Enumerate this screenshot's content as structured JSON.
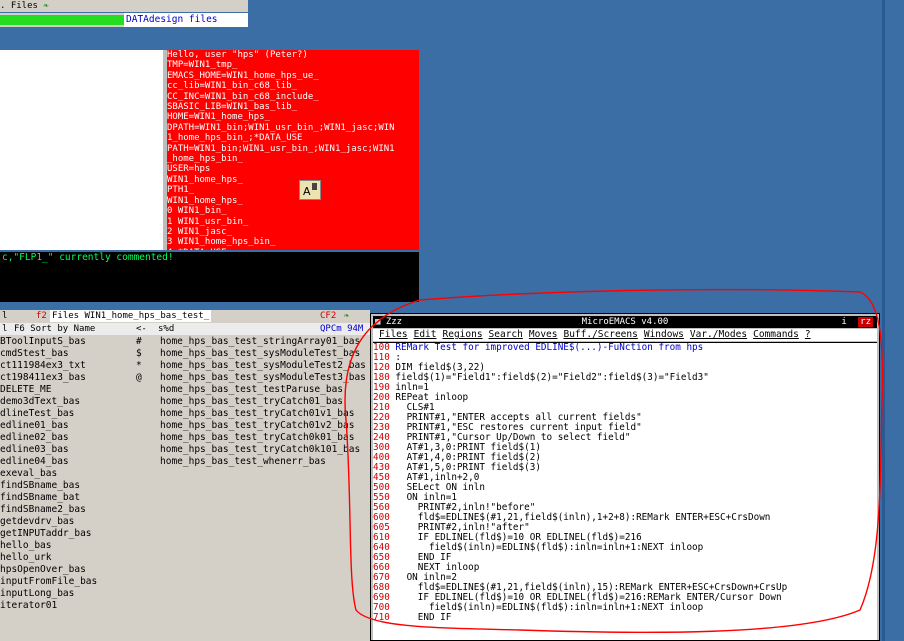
{
  "top_bar": {
    "title": ". Files",
    "progress_fraction": 0.5,
    "progress_label": "DATAdesign files"
  },
  "env_pane": {
    "lines": [
      "Hello, user \"hps\" (Peter?)",
      "TMP=WIN1_tmp_",
      "EMACS_HOME=WIN1_home_hps_ue_",
      "cc_lib=WIN1_bin_c68_lib_",
      "CC_INC=WIN1_bin_c68_include_",
      "SBASIC_LIB=WIN1_bas_lib_",
      "HOME=WIN1_home_hps_",
      "DPATH=WIN1_bin;WIN1_usr_bin_;WIN1_jasc;WIN",
      "1_home_hps_bin_;*DATA_USE",
      "PATH=WIN1_bin;WIN1_usr_bin_;WIN1_jasc;WIN1",
      "_home_hps_bin_",
      "USER=hps",
      "WIN1_home_hps_",
      "PTH1_",
      "WIN1_home_hps_",
      "0     WIN1_bin_",
      "1     WIN1_usr_bin_",
      "2     WIN1_jasc_",
      "3     WIN1_home_hps_bin_",
      "4     *DATA_USE_"
    ]
  },
  "console": {
    "line": "c,\"FLP1_\" currently commented!"
  },
  "file_window": {
    "title_left": "l",
    "title_f2": "f2",
    "title_path": "Files WIN1_home_hps_bas_test_",
    "title_right": "CF2",
    "header_left": "l",
    "header_sort": "F6 Sort by Name",
    "header_mid": "<-",
    "header_col3": "s%d",
    "header_right": "QPCm 94M",
    "rows": [
      {
        "name": "BToolInputS_bas",
        "mark": "#",
        "right": "home_hps_bas_test_stringArray01_bas"
      },
      {
        "name": "cmdStest_bas",
        "mark": "$",
        "right": "home_hps_bas_test_sysModuleTest_bas"
      },
      {
        "name": "ct111984ex3_txt",
        "mark": "*",
        "right": "home_hps_bas_test_sysModuleTest2_bas"
      },
      {
        "name": "ct198411ex3_bas",
        "mark": "@",
        "right": "home_hps_bas_test_sysModuleTest3_bas"
      },
      {
        "name": "DELETE_ME",
        "mark": "",
        "right": "home_hps_bas_test_testParuse_bas"
      },
      {
        "name": "demo3dText_bas",
        "mark": "",
        "right": "home_hps_bas_test_tryCatch01_bas"
      },
      {
        "name": "dlineTest_bas",
        "mark": "",
        "right": "home_hps_bas_test_tryCatch01v1_bas"
      },
      {
        "name": "edline01_bas",
        "mark": "",
        "right": "home_hps_bas_test_tryCatch01v2_bas"
      },
      {
        "name": "edline02_bas",
        "mark": "",
        "right": "home_hps_bas_test_tryCatch0k01_bas"
      },
      {
        "name": "edline03_bas",
        "mark": "",
        "right": "home_hps_bas_test_tryCatch0k101_bas"
      },
      {
        "name": "edline04_bas",
        "mark": "",
        "right": "home_hps_bas_test_whenerr_bas"
      },
      {
        "name": "exeval_bas",
        "mark": "",
        "right": ""
      },
      {
        "name": "findSBname_bas",
        "mark": "",
        "right": ""
      },
      {
        "name": "findSBname_bat",
        "mark": "",
        "right": ""
      },
      {
        "name": "findSBname2_bas",
        "mark": "",
        "right": ""
      },
      {
        "name": "getdevdrv_bas",
        "mark": "",
        "right": ""
      },
      {
        "name": "getINPUTaddr_bas",
        "mark": "",
        "right": ""
      },
      {
        "name": "hello_bas",
        "mark": "",
        "right": ""
      },
      {
        "name": "hello_urk",
        "mark": "",
        "right": ""
      },
      {
        "name": "hpsOpenOver_bas",
        "mark": "",
        "right": ""
      },
      {
        "name": "inputFromFile_bas",
        "mark": "",
        "right": ""
      },
      {
        "name": "inputLong_bas",
        "mark": "",
        "right": ""
      },
      {
        "name": "iterator01",
        "mark": "",
        "right": ""
      }
    ]
  },
  "emacs": {
    "title_left": "Zzz",
    "title": "MicroEMACS v4.00",
    "title_buttons": [
      "i",
      "rz"
    ],
    "menu": [
      "Files",
      "Edit",
      "Regions",
      "Search",
      "Moves",
      "Buff./Screens",
      "Windows",
      "Var./Modes",
      "Commands",
      "?"
    ],
    "lines": [
      {
        "no": "100",
        "text": " REMark Test for improved EDLINE$(...)-FuNction from hps",
        "rem": true
      },
      {
        "no": "110",
        "text": " :",
        "rem": false
      },
      {
        "no": "120",
        "text": " DIM field$(3,22)",
        "rem": false
      },
      {
        "no": "180",
        "text": " field$(1)=\"Field1\":field$(2)=\"Field2\":field$(3)=\"Field3\"",
        "rem": false
      },
      {
        "no": "190",
        "text": " inln=1",
        "rem": false
      },
      {
        "no": "200",
        "text": " REPeat inloop",
        "rem": false
      },
      {
        "no": "210",
        "text": "   CLS#1",
        "rem": false
      },
      {
        "no": "220",
        "text": "   PRINT#1,\"ENTER accepts all current fields\"",
        "rem": false
      },
      {
        "no": "230",
        "text": "   PRINT#1,\"ESC restores current input field\"",
        "rem": false
      },
      {
        "no": "240",
        "text": "   PRINT#1,\"Cursor Up/Down to select field\"",
        "rem": false
      },
      {
        "no": "300",
        "text": "   AT#1,3,0:PRINT field$(1)",
        "rem": false
      },
      {
        "no": "400",
        "text": "   AT#1,4,0:PRINT field$(2)",
        "rem": false
      },
      {
        "no": "430",
        "text": "   AT#1,5,0:PRINT field$(3)",
        "rem": false
      },
      {
        "no": "450",
        "text": "   AT#1,inln+2,0",
        "rem": false
      },
      {
        "no": "500",
        "text": "   SELect ON inln",
        "rem": false
      },
      {
        "no": "550",
        "text": "   ON inln=1",
        "rem": false
      },
      {
        "no": "560",
        "text": "     PRINT#2,inln!\"before\"",
        "rem": false
      },
      {
        "no": "600",
        "text": "     fld$=EDLINE$(#1,21,field$(inln),1+2+8):REMark ENTER+ESC+CrsDown",
        "rem": false
      },
      {
        "no": "605",
        "text": "     PRINT#2,inln!\"after\"",
        "rem": false
      },
      {
        "no": "610",
        "text": "     IF EDLINEL(fld$)=10 OR EDLINEL(fld$)=216",
        "rem": false
      },
      {
        "no": "640",
        "text": "       field$(inln)=EDLIN$(fld$):inln=inln+1:NEXT inloop",
        "rem": false
      },
      {
        "no": "650",
        "text": "     END IF",
        "rem": false
      },
      {
        "no": "660",
        "text": "     NEXT inloop",
        "rem": false
      },
      {
        "no": "670",
        "text": "   ON inln=2",
        "rem": false
      },
      {
        "no": "680",
        "text": "     fld$=EDLINE$(#1,21,field$(inln),15):REMark ENTER+ESC+CrsDown+CrsUp",
        "rem": false
      },
      {
        "no": "690",
        "text": "     IF EDLINEL(fld$)=10 OR EDLINEL(fld$)=216:REMark ENTER/Cursor Down",
        "rem": false
      },
      {
        "no": "700",
        "text": "       field$(inln)=EDLIN$(fld$):inln=inln+1:NEXT inloop",
        "rem": false
      },
      {
        "no": "710",
        "text": "     END IF",
        "rem": false
      }
    ]
  },
  "colors": {
    "desktop": "#3a6ea5",
    "env_background": "#ff0000",
    "console_text": "#00ff55",
    "line_numbers": "#cc0000",
    "remark": "#0000cc",
    "annotation": "#ff0000"
  }
}
